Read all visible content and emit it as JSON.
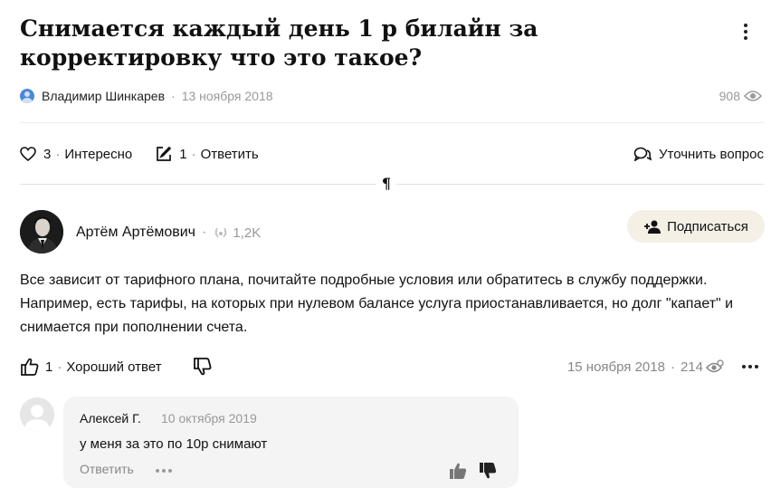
{
  "question": {
    "title": "Снимается каждый день 1 р билайн за корректировку что это такое?",
    "author": "Владимир Шинкарев",
    "date": "13 ноября 2018",
    "views": "908",
    "interesting_count": "3",
    "interesting_label": "Интересно",
    "answers_count": "1",
    "answer_label": "Ответить",
    "clarify_label": "Уточнить вопрос"
  },
  "divider_mark": "¶",
  "answer": {
    "author": "Артём Артёмович",
    "rating": "1,2K",
    "subscribe_label": "Подписаться",
    "text": "Все зависит от тарифного плана, почитайте подробные условия или обратитесь в службу поддержки. Например, есть тарифы, на которых при нулевом балансе услуга приостанавливается, но долг \"капает\" и снимается при пополнении счета.",
    "likes": "1",
    "good_label": "Хороший ответ",
    "date": "15 ноября 2018",
    "views": "214"
  },
  "comment": {
    "author": "Алексей Г.",
    "date": "10 октября 2019",
    "text": "у меня за это по 10р снимают",
    "reply_label": "Ответить"
  },
  "colors": {
    "accent_beige": "#f5f0e6",
    "muted_text": "#999999",
    "comment_bg": "#f4f4f4"
  }
}
